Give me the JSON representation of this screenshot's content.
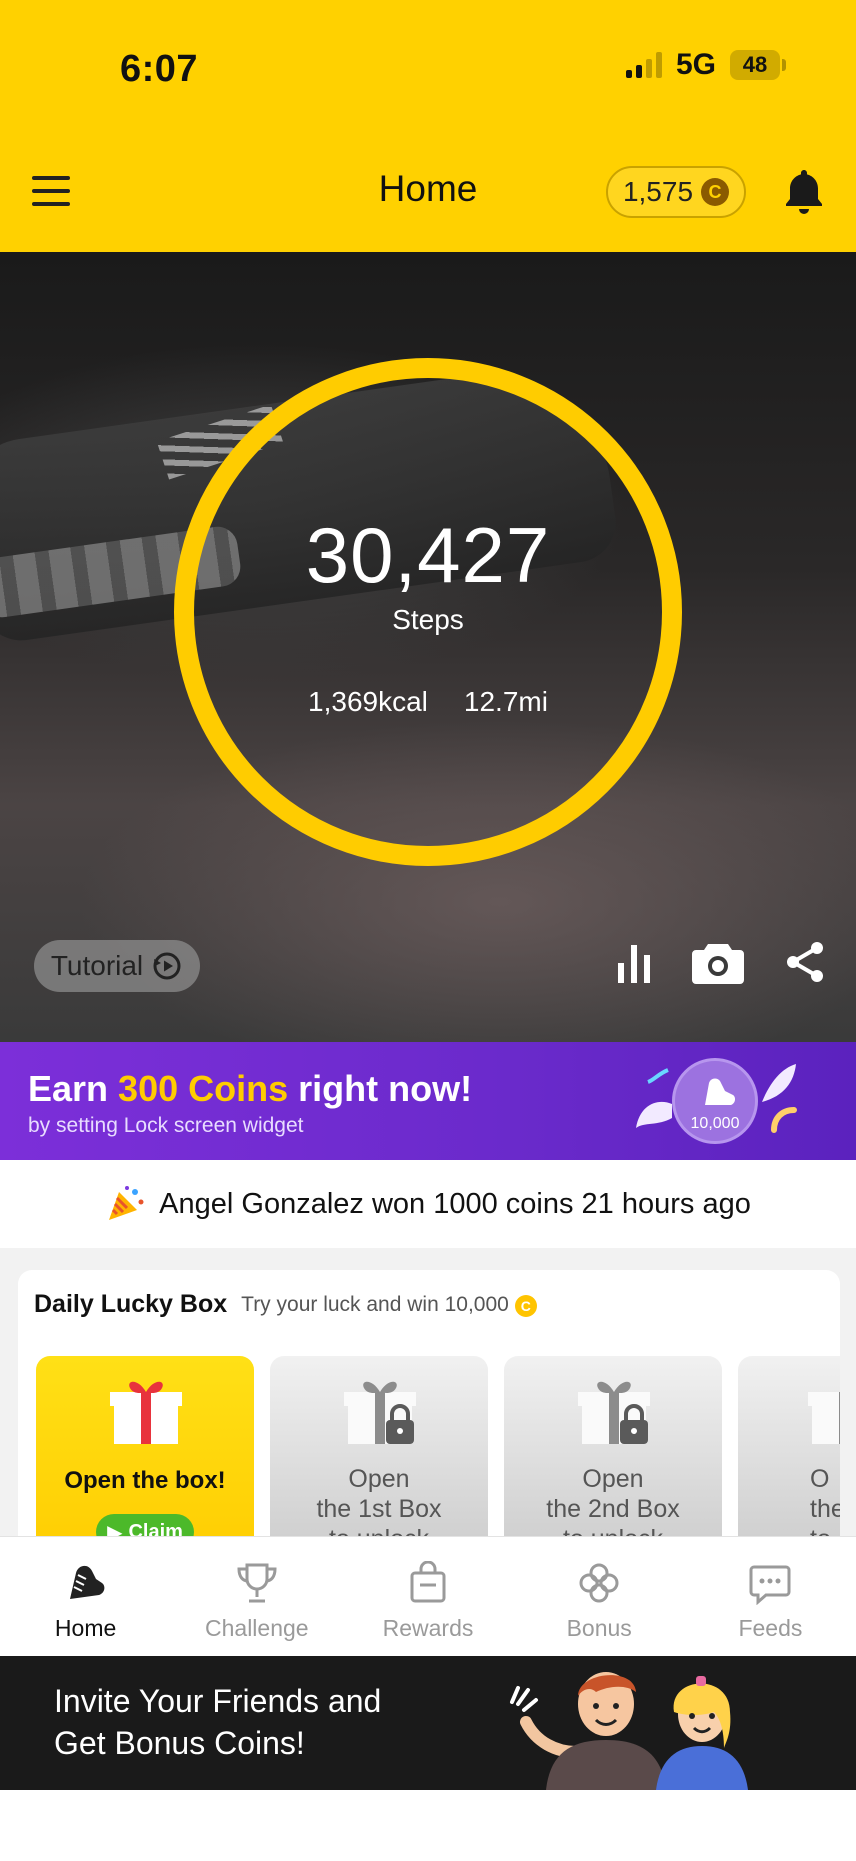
{
  "status_bar": {
    "time": "6:07",
    "network": "5G",
    "battery": "48"
  },
  "header": {
    "title": "Home",
    "coins": "1,575",
    "coin_symbol": "C"
  },
  "hero": {
    "steps": "30,427",
    "steps_label": "Steps",
    "calories": "1,369kcal",
    "distance": "12.7mi",
    "tutorial_label": "Tutorial"
  },
  "promo": {
    "prefix": "Earn ",
    "highlight": "300 Coins",
    "suffix": " right now!",
    "subtitle": "by setting Lock screen widget",
    "medal_label": "10,000"
  },
  "ticker": {
    "text": "Angel Gonzalez won 1000 coins 21 hours ago"
  },
  "lucky_box": {
    "title": "Daily Lucky Box",
    "subtitle": "Try your luck and win 10,000",
    "coin_symbol": "C",
    "boxes": [
      {
        "text": "Open the box!",
        "button": "Claim"
      },
      {
        "line1": "Open",
        "line2": "the 1st Box",
        "line3": "to unlock"
      },
      {
        "line1": "Open",
        "line2": "the 2nd Box",
        "line3": "to unlock"
      },
      {
        "line1": "O",
        "line2": "the",
        "line3": "to"
      }
    ]
  },
  "tabs": [
    {
      "label": "Home",
      "icon": "shoe-icon",
      "active": true
    },
    {
      "label": "Challenge",
      "icon": "trophy-icon"
    },
    {
      "label": "Rewards",
      "icon": "shopping-bag-icon"
    },
    {
      "label": "Bonus",
      "icon": "clover-icon"
    },
    {
      "label": "Feeds",
      "icon": "chat-bubble-icon"
    }
  ],
  "invite": {
    "line1": "Invite Your Friends and",
    "line2": "Get Bonus Coins!"
  },
  "colors": {
    "brand_yellow": "#ffd100",
    "ring": "#ffcc00",
    "promo_purple": "#7c2fd9",
    "claim_green": "#4cb92a"
  }
}
